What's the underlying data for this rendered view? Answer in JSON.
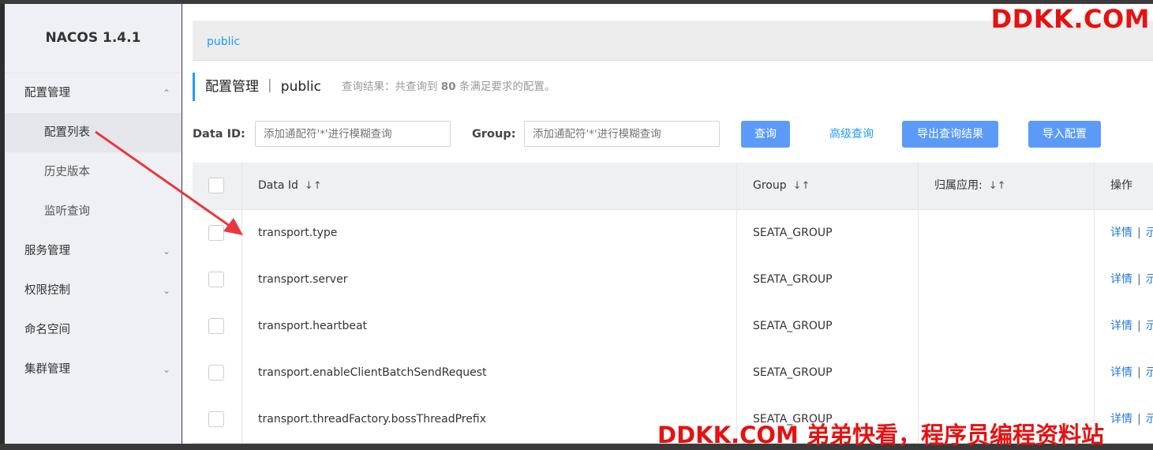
{
  "sidebar": {
    "brand": "NACOS 1.4.1",
    "items": [
      {
        "label": "配置管理",
        "chevron": "up"
      },
      {
        "label": "配置列表"
      },
      {
        "label": "历史版本"
      },
      {
        "label": "监听查询"
      },
      {
        "label": "服务管理",
        "chevron": "down"
      },
      {
        "label": "权限控制",
        "chevron": "down"
      },
      {
        "label": "命名空间"
      },
      {
        "label": "集群管理",
        "chevron": "down"
      }
    ]
  },
  "namespace": {
    "tab": "public"
  },
  "title": {
    "text": "配置管理 ｜ public",
    "result_prefix": "查询结果：共查询到 ",
    "result_count": "80",
    "result_suffix": " 条满足要求的配置。"
  },
  "search": {
    "dataid_label": "Data ID:",
    "dataid_placeholder": "添加通配符'*'进行模糊查询",
    "group_label": "Group:",
    "group_placeholder": "添加通配符'*'进行模糊查询",
    "query_button": "查询",
    "advanced_link": "高级查询",
    "export_button": "导出查询结果",
    "import_button": "导入配置"
  },
  "table": {
    "headers": {
      "dataid": "Data Id",
      "group": "Group",
      "app": "归属应用:",
      "ops": "操作"
    },
    "rows": [
      {
        "dataid": "transport.type",
        "group": "SEATA_GROUP",
        "detail": "详情",
        "sep": "|",
        "more": "示"
      },
      {
        "dataid": "transport.server",
        "group": "SEATA_GROUP",
        "detail": "详情",
        "sep": "|",
        "more": "示"
      },
      {
        "dataid": "transport.heartbeat",
        "group": "SEATA_GROUP",
        "detail": "详情",
        "sep": "|",
        "more": "示"
      },
      {
        "dataid": "transport.enableClientBatchSendRequest",
        "group": "SEATA_GROUP",
        "detail": "详情",
        "sep": "|",
        "more": "示"
      },
      {
        "dataid": "transport.threadFactory.bossThreadPrefix",
        "group": "SEATA_GROUP",
        "detail": "详情",
        "sep": "|",
        "more": "示"
      }
    ]
  },
  "watermarks": {
    "top": "DDKK.COM",
    "bottom": "DDKK.COM 弟弟快看，程序员编程资料站"
  },
  "colors": {
    "accent": "#209bfa",
    "button": "#5b9bf7",
    "watermark": "#e61212",
    "arrow": "#e8383d"
  }
}
